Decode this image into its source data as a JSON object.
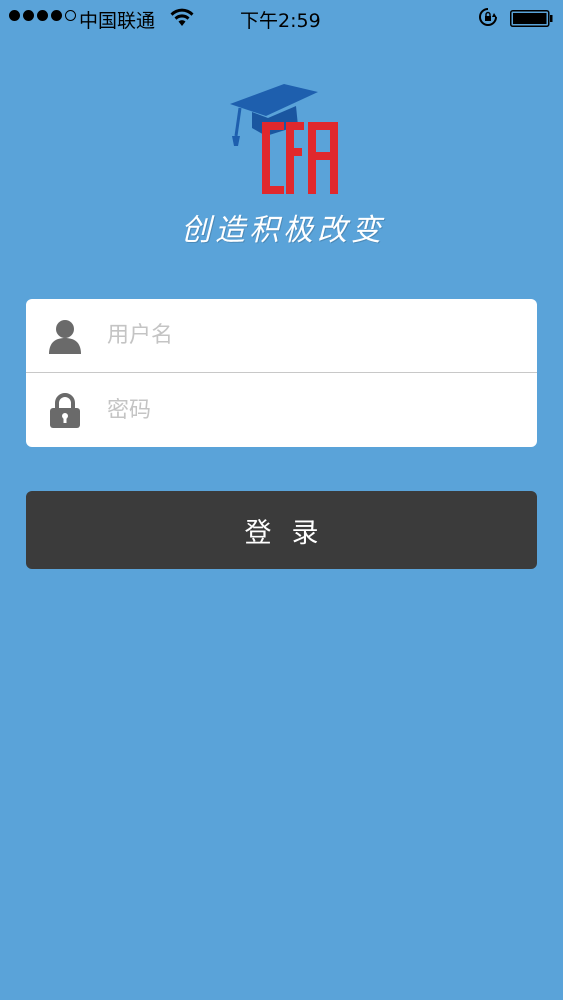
{
  "status_bar": {
    "carrier": "中国联通",
    "time": "下午2:59",
    "signal_bars_filled": 4,
    "signal_bars_total": 5
  },
  "brand": {
    "slogan": "创造积极改变",
    "logo_text": "CFA",
    "logo_colors": {
      "cap": "#1e5fae",
      "letters": "#e0282d"
    }
  },
  "login_form": {
    "username_placeholder": "用户名",
    "password_placeholder": "密码",
    "username_icon": "user-icon",
    "password_icon": "lock-icon",
    "submit_label": "登录"
  },
  "colors": {
    "background": "#5aa3d9",
    "button": "#3b3b3b"
  }
}
